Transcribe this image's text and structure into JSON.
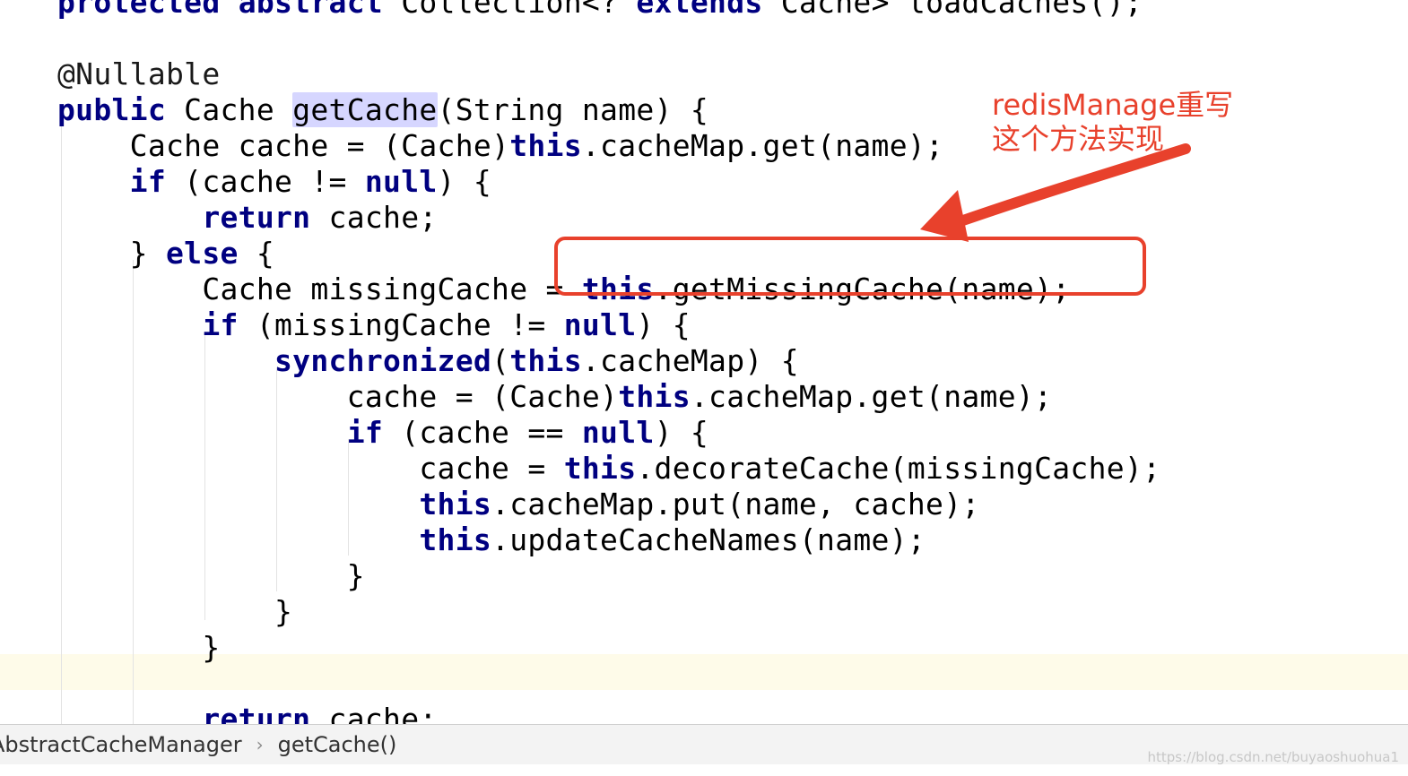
{
  "editor": {
    "lines": [
      [
        {
          "t": "protected",
          "k": "kw"
        },
        {
          "t": " "
        },
        {
          "t": "abstract",
          "k": "kw"
        },
        {
          "t": " Collection<? "
        },
        {
          "t": "extends",
          "k": "kw"
        },
        {
          "t": " Cache> loadCaches();"
        }
      ],
      [],
      [
        {
          "t": "@Nullable",
          "k": "ann"
        }
      ],
      [
        {
          "t": "public",
          "k": "kw"
        },
        {
          "t": " Cache "
        },
        {
          "t": "getCache",
          "k": "hl"
        },
        {
          "t": "(String name) {"
        }
      ],
      [
        {
          "t": "    Cache cache = (Cache)"
        },
        {
          "t": "this",
          "k": "kw"
        },
        {
          "t": ".cacheMap.get(name);"
        }
      ],
      [
        {
          "t": "    "
        },
        {
          "t": "if",
          "k": "kw"
        },
        {
          "t": " (cache != "
        },
        {
          "t": "null",
          "k": "kw"
        },
        {
          "t": ") {"
        }
      ],
      [
        {
          "t": "        "
        },
        {
          "t": "return",
          "k": "kw"
        },
        {
          "t": " cache;"
        }
      ],
      [
        {
          "t": "    } "
        },
        {
          "t": "else",
          "k": "kw"
        },
        {
          "t": " {"
        }
      ],
      [
        {
          "t": "        Cache missingCache = "
        },
        {
          "t": "this",
          "k": "kw"
        },
        {
          "t": ".getMissingCache(name);"
        }
      ],
      [
        {
          "t": "        "
        },
        {
          "t": "if",
          "k": "kw"
        },
        {
          "t": " (missingCache != "
        },
        {
          "t": "null",
          "k": "kw"
        },
        {
          "t": ") {"
        }
      ],
      [
        {
          "t": "            "
        },
        {
          "t": "synchronized",
          "k": "kw"
        },
        {
          "t": "("
        },
        {
          "t": "this",
          "k": "kw"
        },
        {
          "t": ".cacheMap) {"
        }
      ],
      [
        {
          "t": "                cache = (Cache)"
        },
        {
          "t": "this",
          "k": "kw"
        },
        {
          "t": ".cacheMap.get(name);"
        }
      ],
      [
        {
          "t": "                "
        },
        {
          "t": "if",
          "k": "kw"
        },
        {
          "t": " (cache == "
        },
        {
          "t": "null",
          "k": "kw"
        },
        {
          "t": ") {"
        }
      ],
      [
        {
          "t": "                    cache = "
        },
        {
          "t": "this",
          "k": "kw"
        },
        {
          "t": ".decorateCache(missingCache);"
        }
      ],
      [
        {
          "t": "                    "
        },
        {
          "t": "this",
          "k": "kw"
        },
        {
          "t": ".cacheMap.put(name, cache);"
        }
      ],
      [
        {
          "t": "                    "
        },
        {
          "t": "this",
          "k": "kw"
        },
        {
          "t": ".updateCacheNames(name);"
        }
      ],
      [
        {
          "t": "                }"
        }
      ],
      [
        {
          "t": "            }"
        }
      ],
      [
        {
          "t": "        }"
        }
      ],
      [],
      [
        {
          "t": "        "
        },
        {
          "t": "return",
          "k": "kw"
        },
        {
          "t": " cache;"
        }
      ]
    ]
  },
  "annotation": {
    "text": "redisManage重写这个方法实现",
    "color": "#e8412c"
  },
  "breadcrumb": {
    "items": [
      "AbstractCacheManager",
      "getCache()"
    ],
    "separator": "›"
  },
  "watermark": "https://blog.csdn.net/buyaoshuohua1",
  "colors": {
    "keyword": "#000080",
    "highlight": "#d6d6ff",
    "caret_line": "#fefbe9",
    "annotation": "#e8412c"
  }
}
